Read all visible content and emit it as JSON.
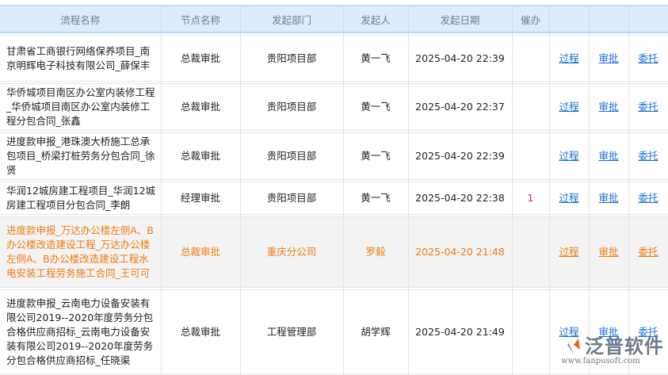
{
  "headers": [
    "流程名称",
    "节点名称",
    "发起部门",
    "发起人",
    "发起日期",
    "催办",
    "",
    "",
    ""
  ],
  "rows": [
    {
      "name": "甘肃省工商银行网络保养项目_南京明辉电子科技有限公司_薛保丰",
      "node": "总裁审批",
      "dept": "贵阳项目部",
      "person": "黄一飞",
      "date": "2025-04-20 22:39",
      "urge": "",
      "links": [
        "过程",
        "审批",
        "委托"
      ]
    },
    {
      "name": "华侨城项目南区办公室内装修工程_华侨城项目南区办公室内装修工程分包合同_张鑫",
      "node": "总裁审批",
      "dept": "贵阳项目部",
      "person": "黄一飞",
      "date": "2025-04-20 22:37",
      "urge": "",
      "links": [
        "过程",
        "审批",
        "委托"
      ]
    },
    {
      "name": "进度款申报_港珠澳大桥施工总承包项目_桥梁打桩劳务分包合同_徐贤",
      "node": "总裁审批",
      "dept": "贵阳项目部",
      "person": "黄一飞",
      "date": "2025-04-20 22:39",
      "urge": "",
      "links": [
        "过程",
        "审批",
        "委托"
      ]
    },
    {
      "name": "华润12城房建工程项目_华润12城房建工程项目分包合同_李朗",
      "node": "经理审批",
      "dept": "贵阳项目部",
      "person": "黄一飞",
      "date": "2025-04-20 22:38",
      "urge": "1",
      "links": [
        "过程",
        "审批",
        "委托"
      ]
    },
    {
      "name": "进度款申报_万达办公楼左侧A、B办公楼改造建设工程_万达办公楼左侧A、B办公楼改造建设工程水电安装工程劳务施工合同_王可可",
      "node": "总裁审批",
      "dept": "重庆分公司",
      "person": "罗毅",
      "date": "2025-04-20 21:48",
      "urge": "",
      "links": [
        "过程",
        "审批",
        "委托"
      ]
    },
    {
      "name": "进度款申报_云南电力设备安装有限公司2019--2020年度劳务分包合格供应商招标_云南电力设备安装有限公司2019--2020年度劳务分包合格供应商招标_任晓渠",
      "node": "总裁审批",
      "dept": "工程管理部",
      "person": "胡学辉",
      "date": "2025-04-20 21:49",
      "urge": "",
      "links": [
        "过程",
        "审批",
        "委托"
      ]
    }
  ],
  "logo": {
    "text": "泛普软件",
    "url": "www.fanpusoft.com"
  },
  "colors": {
    "highlight": "#ef7b10",
    "link": "#1a6fd8",
    "header_bg": "#dcecfb"
  }
}
